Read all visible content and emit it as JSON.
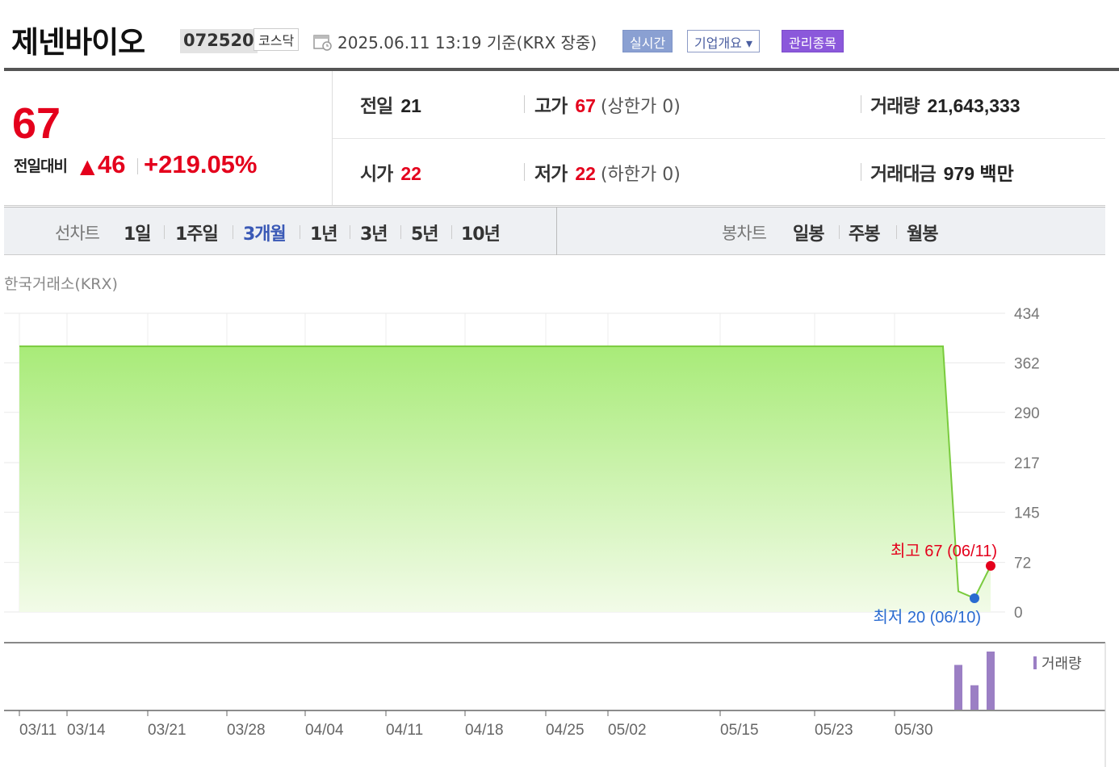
{
  "header": {
    "company_name": "제넨바이오",
    "stock_code": "072520",
    "market": "코스닥",
    "datetime": "2025.06.11 13:19  기준(KRX 장중)",
    "buttons": {
      "realtime": "실시간",
      "company_info": "기업개요 ▾",
      "managed": "관리종목"
    }
  },
  "price": {
    "current": "67",
    "compare_label": "전일대비",
    "arrow": "▲",
    "change": "46",
    "change_rate": "+219.05%"
  },
  "stats": {
    "prev_close": {
      "label": "전일",
      "value": "21"
    },
    "high": {
      "label": "고가",
      "value": "67",
      "sub": "(상한가 0)"
    },
    "volume": {
      "label": "거래량",
      "value": "21,643,333"
    },
    "open": {
      "label": "시가",
      "value": "22"
    },
    "low": {
      "label": "저가",
      "value": "22",
      "sub": "(하한가 0)"
    },
    "amount": {
      "label": "거래대금",
      "value": "979 백만"
    }
  },
  "tabs": {
    "line_label": "선차트",
    "periods": [
      "1일",
      "1주일",
      "3개월",
      "1년",
      "3년",
      "5년",
      "10년"
    ],
    "active_period": "3개월",
    "candle_label": "봉차트",
    "candles": [
      "일봉",
      "주봉",
      "월봉"
    ]
  },
  "chart_source": "한국거래소(KRX)",
  "chart_data": {
    "type": "area",
    "x_ticks": [
      "03/11",
      "03/14",
      "03/21",
      "03/28",
      "04/04",
      "04/11",
      "04/18",
      "04/25",
      "05/02",
      "05/15",
      "05/23",
      "05/30"
    ],
    "y_ticks": [
      "434",
      "362",
      "290",
      "217",
      "145",
      "72",
      "0"
    ],
    "ylim": [
      0,
      434
    ],
    "series": [
      {
        "x": [
          "03/11",
          "06/04",
          "06/09",
          "06/10",
          "06/11"
        ],
        "values": [
          386,
          386,
          30,
          20,
          67
        ]
      }
    ],
    "annotations": {
      "high": "최고 67 (06/11)",
      "low": "최저 20 (06/10)"
    },
    "volume_label": "거래량",
    "volume_bars": [
      0.77,
      0.42,
      1.0
    ],
    "colors": {
      "line": "#7acb3e",
      "fill_top": "#a8eb78",
      "fill_bottom": "#f2fbe8",
      "high": "#e4001c",
      "low": "#2a6bd1",
      "volume": "#9b7fc4"
    }
  }
}
